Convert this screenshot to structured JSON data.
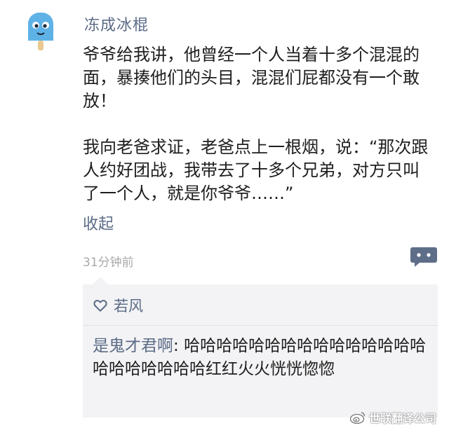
{
  "post": {
    "username": "冻成冰棍",
    "paragraphs": [
      "爷爷给我讲，他曾经一个人当着十多个混混的面，暴揍他们的头目，混混们屁都没有一个敢放！",
      "我向老爸求证，老爸点上一根烟，说：“那次跟人约好团战，我带去了十多个兄弟，对方只叫了一个人，就是你爷爷……”"
    ],
    "collapse_label": "收起",
    "timestamp": "31分钟前"
  },
  "interactions": {
    "likes": "若风",
    "comment": {
      "author": "是鬼才君啊",
      "separator": ": ",
      "text": "哈哈哈哈哈哈哈哈哈哈哈哈哈哈哈哈哈哈哈哈哈哈红红火火恍恍惚惚"
    }
  },
  "watermark": {
    "text": "世联翻译公司"
  },
  "icons": {
    "avatar": "popsicle-avatar-icon",
    "reply": "comment-bubble-icon",
    "like": "heart-outline-icon",
    "watermark": "weibo-logo-icon"
  },
  "colors": {
    "link": "#5b6b86",
    "body_text": "#1e1e1e",
    "timestamp": "#a9a9a9",
    "panel_bg": "#f3f3f5",
    "avatar_blue": "#5fb2e6"
  }
}
